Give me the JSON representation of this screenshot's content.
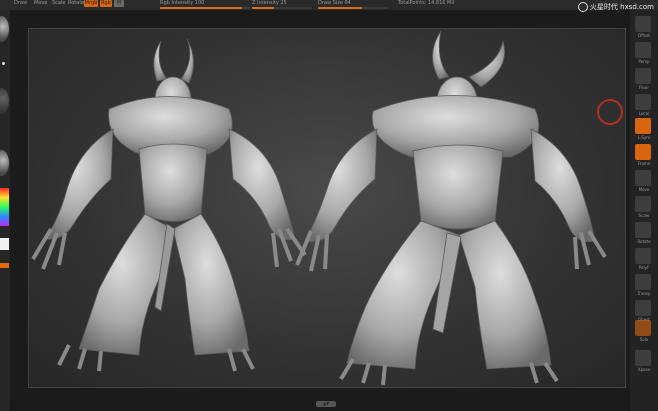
{
  "toolbar": {
    "items": [
      "Draw",
      "Move",
      "Scale",
      "Rotate",
      "Mrgb",
      "Rgb",
      "M"
    ],
    "rgb_intensity": "Rgb Intensity 100",
    "z_intensity": "Z Intensity 25",
    "draw_size": "Draw Size 64",
    "total_points": "TotalPoints: 14.816 Mil",
    "logo": "火星时代 hxsd.com"
  },
  "right_shelf": {
    "labels": [
      "Offset",
      "Persp",
      "Floor",
      "Local",
      "L.Sym",
      "Frame",
      "Move",
      "Scale",
      "Rotate",
      "PolyF",
      "Transp",
      "Ghost",
      "Solo",
      "Xpose"
    ]
  },
  "bottom": {
    "tab": "▲▼"
  },
  "colors": {
    "accent": "#e06a10",
    "viewport_bg": "#3a3a3a"
  }
}
